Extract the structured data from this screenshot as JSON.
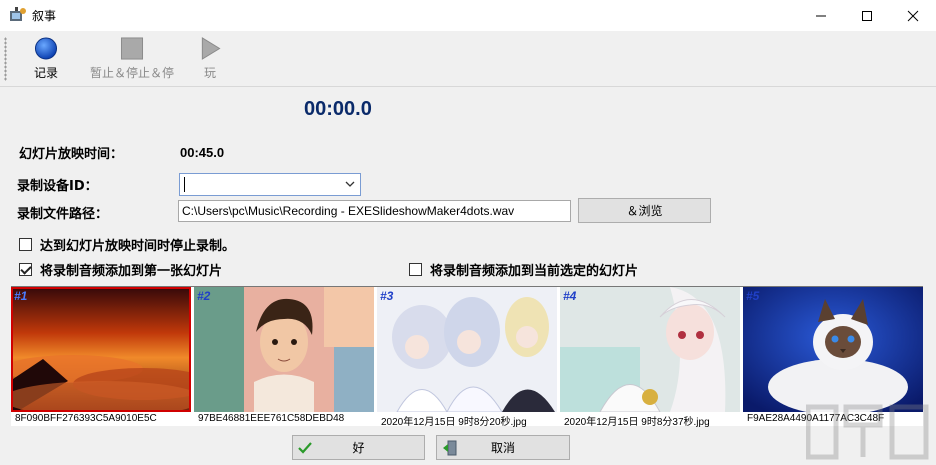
{
  "window": {
    "title": "叙事"
  },
  "toolbar": {
    "record_label": "记录",
    "pause_stop_label": "暂止＆停止＆停",
    "play_label": "玩"
  },
  "timer": {
    "value": "00:00.0"
  },
  "form": {
    "slide_time_label": "幻灯片放映时间：",
    "slide_time_value": "00:45.0",
    "device_label": "录制设备ID：",
    "device_value": "",
    "path_label": "录制文件路径：",
    "path_value": "C:\\Users\\pc\\Music\\Recording - EXESlideshowMaker4dots.wav",
    "browse_label": "＆浏览"
  },
  "options": {
    "stop_on_time": {
      "label": "达到幻灯片放映时间时停止录制。",
      "checked": false
    },
    "add_to_first": {
      "label": "将录制音频添加到第一张幻灯片",
      "checked": true
    },
    "add_to_selected": {
      "label": "将录制音频添加到当前选定的幻灯片",
      "checked": false
    }
  },
  "thumbnails": [
    {
      "num": "#1",
      "caption": "8F090BFF276393C5A9010E5C"
    },
    {
      "num": "#2",
      "caption": "97BE46881EEE761C58DEBD48"
    },
    {
      "num": "#3",
      "caption": "2020年12月15日 9时8分20秒.jpg"
    },
    {
      "num": "#4",
      "caption": "2020年12月15日 9时8分37秒.jpg"
    },
    {
      "num": "#5",
      "caption": "F9AE28A4490A1177AC3C48F"
    }
  ],
  "buttons": {
    "ok_label": "好",
    "cancel_label": "取消"
  },
  "colors": {
    "record_blue": "#1a5fd6",
    "timer_navy": "#0a2a6a",
    "thumb_number": "#2040c8"
  }
}
